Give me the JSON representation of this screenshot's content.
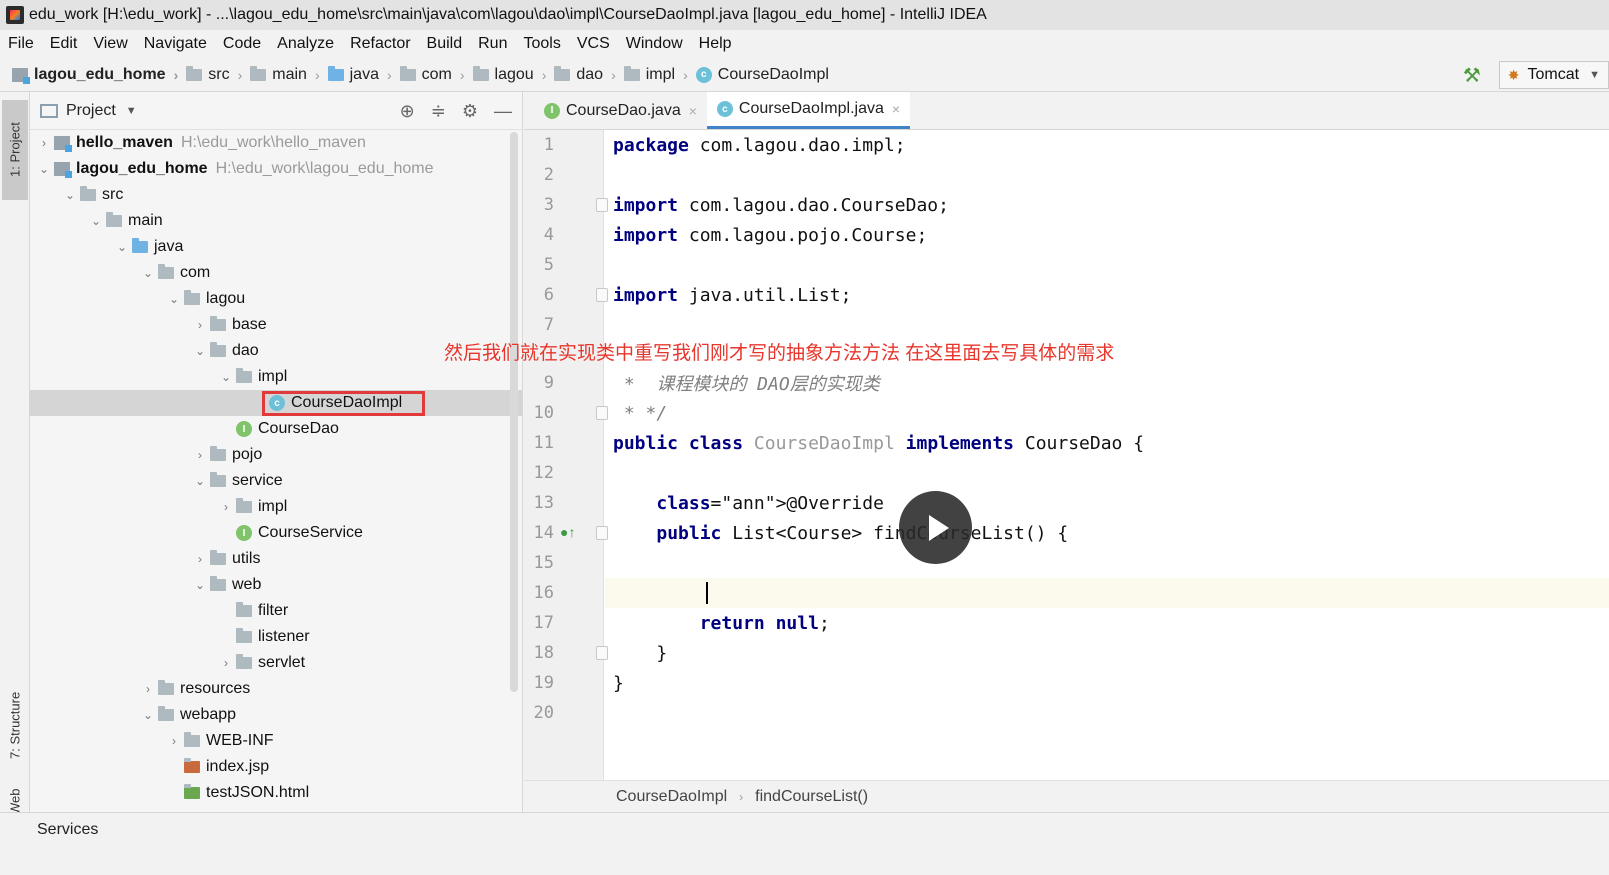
{
  "window": {
    "title": "edu_work [H:\\edu_work] - ...\\lagou_edu_home\\src\\main\\java\\com\\lagou\\dao\\impl\\CourseDaoImpl.java [lagou_edu_home] - IntelliJ IDEA"
  },
  "menu": [
    "File",
    "Edit",
    "View",
    "Navigate",
    "Code",
    "Analyze",
    "Refactor",
    "Build",
    "Run",
    "Tools",
    "VCS",
    "Window",
    "Help"
  ],
  "breadcrumb": [
    "lagou_edu_home",
    "src",
    "main",
    "java",
    "com",
    "lagou",
    "dao",
    "impl",
    "CourseDaoImpl"
  ],
  "run_config": {
    "label": "Tomcat"
  },
  "side_tabs": {
    "project": "1: Project",
    "structure": "7: Structure",
    "web": "Web"
  },
  "project_panel": {
    "title": "Project"
  },
  "tree": [
    {
      "name": "hello_maven",
      "path": "H:\\edu_work\\hello_maven",
      "icon": "module-icon",
      "arrow": ">"
    },
    {
      "name": "lagou_edu_home",
      "path": "H:\\edu_work\\lagou_edu_home",
      "icon": "module-icon",
      "arrow": "v"
    },
    {
      "name": "src",
      "icon": "folder-icon",
      "arrow": "v"
    },
    {
      "name": "main",
      "icon": "folder-icon",
      "arrow": "v"
    },
    {
      "name": "java",
      "icon": "source-folder-icon",
      "arrow": "v"
    },
    {
      "name": "com",
      "icon": "package-icon",
      "arrow": "v"
    },
    {
      "name": "lagou",
      "icon": "package-icon",
      "arrow": "v"
    },
    {
      "name": "base",
      "icon": "package-icon",
      "arrow": ">"
    },
    {
      "name": "dao",
      "icon": "package-icon",
      "arrow": "v"
    },
    {
      "name": "impl",
      "icon": "package-icon",
      "arrow": "v"
    },
    {
      "name": "CourseDaoImpl",
      "icon": "class-icon",
      "arrow": "",
      "selected": true
    },
    {
      "name": "CourseDao",
      "icon": "interface-icon",
      "arrow": ""
    },
    {
      "name": "pojo",
      "icon": "package-icon",
      "arrow": ">"
    },
    {
      "name": "service",
      "icon": "package-icon",
      "arrow": "v"
    },
    {
      "name": "impl",
      "icon": "package-icon",
      "arrow": ">"
    },
    {
      "name": "CourseService",
      "icon": "interface-icon",
      "arrow": ""
    },
    {
      "name": "utils",
      "icon": "package-icon",
      "arrow": ">"
    },
    {
      "name": "web",
      "icon": "package-icon",
      "arrow": "v"
    },
    {
      "name": "filter",
      "icon": "package-icon",
      "arrow": ""
    },
    {
      "name": "listener",
      "icon": "package-icon",
      "arrow": ""
    },
    {
      "name": "servlet",
      "icon": "package-icon",
      "arrow": ">"
    },
    {
      "name": "resources",
      "icon": "resources-folder-icon",
      "arrow": ">"
    },
    {
      "name": "webapp",
      "icon": "web-folder-icon",
      "arrow": "v"
    },
    {
      "name": "WEB-INF",
      "icon": "folder-icon",
      "arrow": ">"
    },
    {
      "name": "index.jsp",
      "icon": "jsp-file-icon",
      "arrow": ""
    },
    {
      "name": "testJSON.html",
      "icon": "html-file-icon",
      "arrow": ""
    }
  ],
  "editor_tabs": [
    {
      "label": "CourseDao.java",
      "icon": "interface-icon",
      "active": false
    },
    {
      "label": "CourseDaoImpl.java",
      "icon": "class-icon",
      "active": true
    }
  ],
  "code_lines": [
    {
      "n": "1",
      "text": "package com.lagou.dao.impl;"
    },
    {
      "n": "2",
      "text": ""
    },
    {
      "n": "3",
      "text": "import com.lagou.dao.CourseDao;"
    },
    {
      "n": "4",
      "text": "import com.lagou.pojo.Course;"
    },
    {
      "n": "5",
      "text": ""
    },
    {
      "n": "6",
      "text": "import java.util.List;"
    },
    {
      "n": "7",
      "text": ""
    },
    {
      "n": "9",
      "text": " *  课程模块的 DAO层的实现类"
    },
    {
      "n": "10",
      "text": " * */"
    },
    {
      "n": "11",
      "text": "public class CourseDaoImpl implements CourseDao {"
    },
    {
      "n": "12",
      "text": ""
    },
    {
      "n": "13",
      "text": "    @Override"
    },
    {
      "n": "14",
      "text": "    public List<Course> findCourseList() {"
    },
    {
      "n": "15",
      "text": ""
    },
    {
      "n": "16",
      "text": ""
    },
    {
      "n": "17",
      "text": "        return null;"
    },
    {
      "n": "18",
      "text": "    }"
    },
    {
      "n": "19",
      "text": "}"
    },
    {
      "n": "20",
      "text": ""
    }
  ],
  "editor_breadcrumb": [
    "CourseDaoImpl",
    "findCourseList()"
  ],
  "bottom": {
    "services": "Services"
  },
  "overlay": {
    "subtitle": "然后我们就在实现类中重写我们刚才写的抽象方法方法  在这里面去写具体的需求"
  },
  "colors": {
    "keyword": "#000080",
    "annotation": "#808000",
    "comment": "#808080",
    "tab_active": "#4083c9",
    "subtitle": "#e8362c",
    "selection_box": "#e03a3a"
  }
}
